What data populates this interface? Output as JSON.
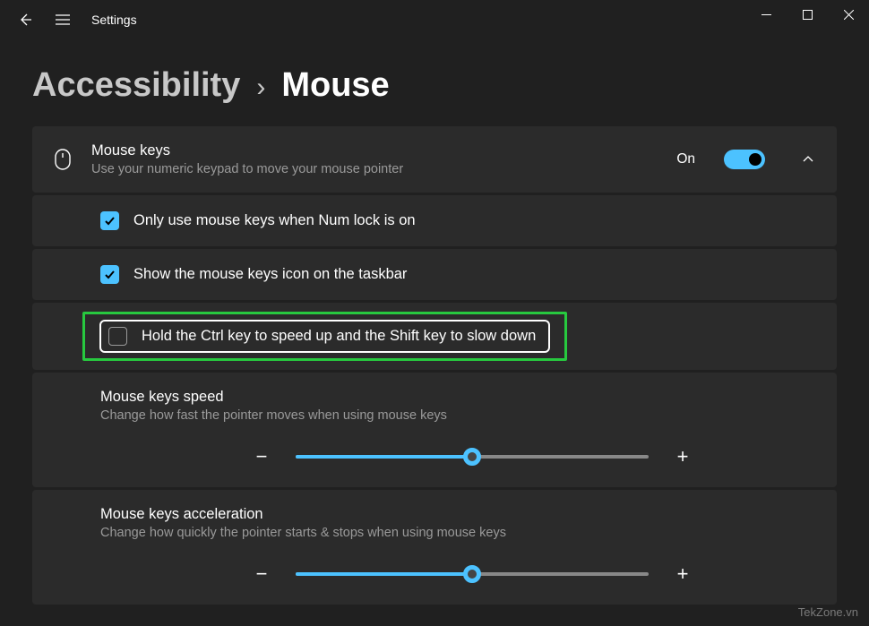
{
  "titlebar": {
    "title": "Settings"
  },
  "breadcrumb": {
    "parent": "Accessibility",
    "separator": "›",
    "current": "Mouse"
  },
  "mouseKeys": {
    "title": "Mouse keys",
    "subtitle": "Use your numeric keypad to move your mouse pointer",
    "stateLabel": "On",
    "enabled": true
  },
  "options": {
    "numlock": {
      "label": "Only use mouse keys when Num lock is on",
      "checked": true
    },
    "taskbarIcon": {
      "label": "Show the mouse keys icon on the taskbar",
      "checked": true
    },
    "ctrlShift": {
      "label": "Hold the Ctrl key to speed up and the Shift key to slow down",
      "checked": false
    }
  },
  "speed": {
    "title": "Mouse keys speed",
    "subtitle": "Change how fast the pointer moves when using mouse keys",
    "value": 50
  },
  "acceleration": {
    "title": "Mouse keys acceleration",
    "subtitle": "Change how quickly the pointer starts & stops when using mouse keys",
    "value": 50
  },
  "watermark": "TekZone.vn"
}
